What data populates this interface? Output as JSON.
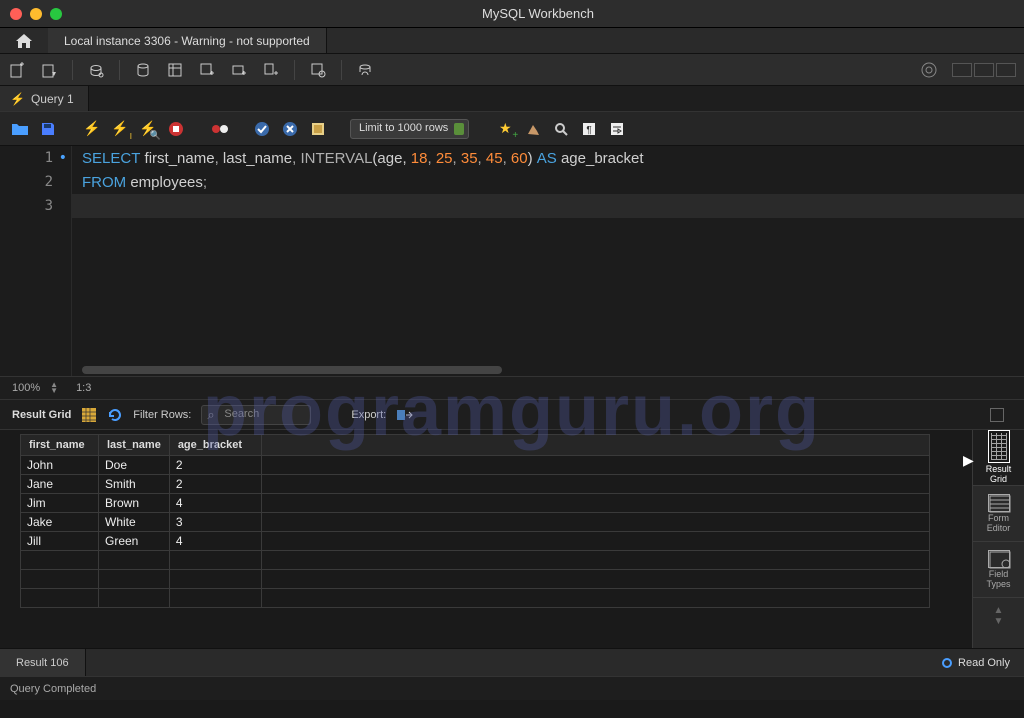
{
  "window": {
    "title": "MySQL Workbench"
  },
  "file_tab": "Local instance 3306 - Warning - not supported",
  "query_tab": "Query 1",
  "limit_selector": "Limit to 1000 rows",
  "sql": {
    "tokens": [
      [
        {
          "t": "SELECT",
          "c": "kw"
        },
        {
          "t": " first_name",
          "c": "id"
        },
        {
          "t": ",",
          "c": "op"
        },
        {
          "t": " last_name",
          "c": "id"
        },
        {
          "t": ",",
          "c": "op"
        },
        {
          "t": " ",
          "c": "op"
        },
        {
          "t": "INTERVAL",
          "c": "fn"
        },
        {
          "t": "(age,",
          "c": "id"
        },
        {
          "t": " ",
          "c": "op"
        },
        {
          "t": "18",
          "c": "num"
        },
        {
          "t": ",",
          "c": "op"
        },
        {
          "t": " ",
          "c": "op"
        },
        {
          "t": "25",
          "c": "num"
        },
        {
          "t": ",",
          "c": "op"
        },
        {
          "t": " ",
          "c": "op"
        },
        {
          "t": "35",
          "c": "num"
        },
        {
          "t": ",",
          "c": "op"
        },
        {
          "t": " ",
          "c": "op"
        },
        {
          "t": "45",
          "c": "num"
        },
        {
          "t": ",",
          "c": "op"
        },
        {
          "t": " ",
          "c": "op"
        },
        {
          "t": "60",
          "c": "num"
        },
        {
          "t": ")",
          "c": "id"
        },
        {
          "t": " ",
          "c": "op"
        },
        {
          "t": "AS",
          "c": "kw"
        },
        {
          "t": " age_bracket",
          "c": "id"
        }
      ],
      [
        {
          "t": "FROM",
          "c": "kw"
        },
        {
          "t": " employees",
          "c": "id"
        },
        {
          "t": ";",
          "c": "op"
        }
      ],
      []
    ]
  },
  "zoom": {
    "pct": "100%",
    "pos": "1:3"
  },
  "grid_toolbar": {
    "label": "Result Grid",
    "filter_label": "Filter Rows:",
    "search_placeholder": "Search",
    "export_label": "Export:"
  },
  "columns": [
    "first_name",
    "last_name",
    "age_bracket"
  ],
  "rows": [
    [
      "John",
      "Doe",
      "2"
    ],
    [
      "Jane",
      "Smith",
      "2"
    ],
    [
      "Jim",
      "Brown",
      "4"
    ],
    [
      "Jake",
      "White",
      "3"
    ],
    [
      "Jill",
      "Green",
      "4"
    ]
  ],
  "side_tabs": {
    "result_grid": "Result\nGrid",
    "form_editor": "Form\nEditor",
    "field_types": "Field\nTypes"
  },
  "result_tab": "Result 106",
  "readonly": "Read Only",
  "status": "Query Completed",
  "watermark": "programguru.org"
}
